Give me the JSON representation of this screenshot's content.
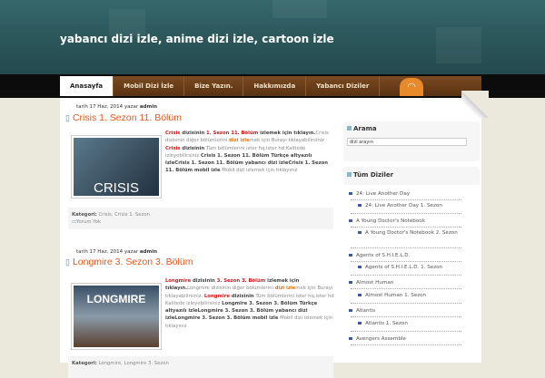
{
  "header": {
    "title": "yabancı dizi izle, anime dizi izle, cartoon izle"
  },
  "nav": [
    "Anasayfa",
    "Mobil Dizi İzle",
    "Bize Yazın.",
    "Hakkımızda",
    "Yabancı Diziler"
  ],
  "posts": [
    {
      "meta_prefix": "tarih 17 Haz, 2014 yazar ",
      "author": "admin",
      "title": "Crisis 1. Sezon 11. Bölüm",
      "thumb": "CRISIS",
      "text": [
        "Crisis",
        " dizisinin ",
        "1. Sezon 11. Bölüm",
        " izlemek için tıklayın.",
        "Crisis dizisinin diğer bölümlerini ",
        "dizi izle",
        "mek için Burayı tıklayabilirsiniz ",
        "Crisis",
        " dizisinin ",
        "Tüm bölümlerini ister hq.ister hd Kalitede izleyebilirsiniz ",
        "Crisis 1. Sezon 11. Bölüm Türkçe altyazılı izleCrisis 1. Sezon 11. Bölüm yabancı dizi izleCrisis 1. Sezon 11. Bölüm mobil izle",
        " Mobil dizi izlemek için tıklayınız"
      ],
      "category_label": "Kategori:",
      "categories": "Crisis, Crisis 1. Sezon",
      "comments": "Yorum Yok"
    },
    {
      "meta_prefix": "tarih 17 Haz, 2014 yazar ",
      "author": "admin",
      "title": "Longmire 3. Sezon 3. Bölüm",
      "thumb": "LONGMIRE",
      "text": [
        "Longmire",
        " dizisinin ",
        "3. Sezon 3. Bölüm",
        " izlemek için tıklayın.",
        "Longmire dizisinin diğer bölümlerini ",
        "dizi izle",
        "mek için Burayı tıklayabilirsiniz. ",
        "Longmire",
        " dizisinin ",
        "Tüm bölümlerini ister hq.ister hd Kalitede izleyebilirsiniz ",
        "Longmire 3. Sezon 3. Bölüm Türkçe altyazılı izleLongmire 3. Sezon 3. Bölüm yabancı dizi izleLongmire 3. Sezon 3. Bölüm mobil izle",
        " Mobil dizi izlemek için tıklayınız"
      ],
      "category_label": "Kategori:",
      "categories": "Longmire, Longmire 3. Sezon"
    }
  ],
  "sidebar": {
    "search_title": "Arama",
    "search_value": "dizi arayın",
    "list_title": "Tüm Diziler",
    "items": [
      "24: Live Another Day",
      "24: Live Another Day 1. Sezon",
      "A Young Doctor's Notebook",
      "A Young Doctor's Notebook 2. Sezon",
      "Agents of S.H.I.E.L.D.",
      "Agents of S.H.I.E.L.D. 1. Sezon",
      "Almost Human",
      "Almost Human 1. Sezon",
      "Atlantis",
      "Atlantis 1. Sezon",
      "Avengers Assemble"
    ]
  }
}
